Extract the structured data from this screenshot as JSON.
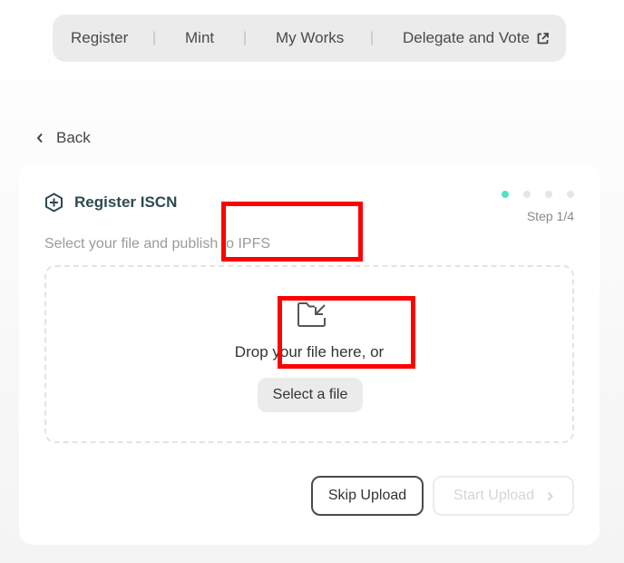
{
  "nav": {
    "items": [
      {
        "label": "Register"
      },
      {
        "label": "Mint"
      },
      {
        "label": "My Works"
      },
      {
        "label": "Delegate and Vote"
      }
    ],
    "separator": "|",
    "external_icon": "external-link-icon"
  },
  "back": {
    "label": "Back",
    "icon": "chevron-left-icon"
  },
  "card": {
    "title": "Register ISCN",
    "title_icon": "plus-hexagon-icon",
    "step_text": "Step 1/4",
    "steps_total": 4,
    "steps_current": 1,
    "subtitle": "Select your file and publish to IPFS",
    "dropzone": {
      "icon": "folder-import-icon",
      "text": "Drop your file here, or",
      "select_label": "Select a file"
    },
    "skip_label": "Skip Upload",
    "start_label": "Start Upload",
    "start_icon": "chevron-right-icon"
  },
  "colors": {
    "accent": "#50e3c2",
    "highlight": "#ff0000",
    "title": "#2d4a50"
  }
}
